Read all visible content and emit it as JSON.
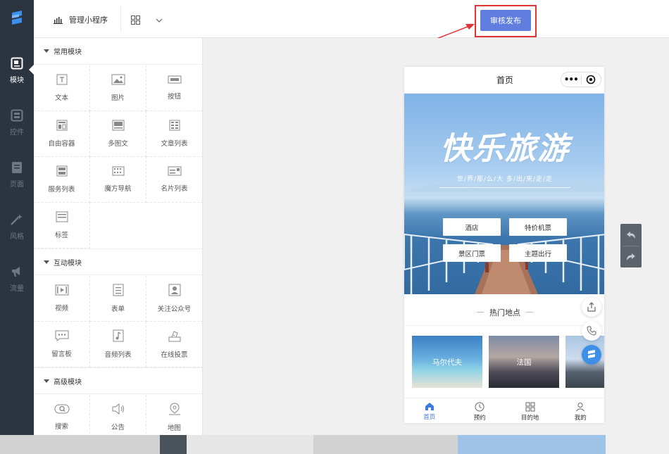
{
  "rail": {
    "items": [
      {
        "label": "模块",
        "icon": "module-icon",
        "active": true
      },
      {
        "label": "控件",
        "icon": "widget-icon",
        "active": false
      },
      {
        "label": "页面",
        "icon": "page-icon",
        "active": false
      },
      {
        "label": "风格",
        "icon": "style-wand-icon",
        "active": false
      },
      {
        "label": "流量",
        "icon": "traffic-megaphone-icon",
        "active": false
      }
    ]
  },
  "topbar": {
    "manage_label": "管理小程序",
    "publish_label": "审核发布"
  },
  "panel": {
    "sections": [
      {
        "title": "常用模块",
        "items": [
          {
            "label": "文本",
            "icon": "text-icon"
          },
          {
            "label": "图片",
            "icon": "image-icon"
          },
          {
            "label": "按钮",
            "icon": "button-icon"
          },
          {
            "label": "自由容器",
            "icon": "container-icon"
          },
          {
            "label": "多图文",
            "icon": "multi-image-text-icon"
          },
          {
            "label": "文章列表",
            "icon": "article-list-icon"
          },
          {
            "label": "服务列表",
            "icon": "service-list-icon"
          },
          {
            "label": "魔方导航",
            "icon": "cube-nav-icon"
          },
          {
            "label": "名片列表",
            "icon": "card-list-icon"
          },
          {
            "label": "标签",
            "icon": "tag-icon"
          }
        ]
      },
      {
        "title": "互动模块",
        "items": [
          {
            "label": "视频",
            "icon": "video-icon"
          },
          {
            "label": "表单",
            "icon": "form-icon"
          },
          {
            "label": "关注公众号",
            "icon": "follow-account-icon"
          },
          {
            "label": "留言板",
            "icon": "message-board-icon"
          },
          {
            "label": "音频列表",
            "icon": "audio-list-icon"
          },
          {
            "label": "在线投票",
            "icon": "vote-icon"
          }
        ]
      },
      {
        "title": "高级模块",
        "items": [
          {
            "label": "搜索",
            "icon": "search-icon"
          },
          {
            "label": "公告",
            "icon": "announcement-icon"
          },
          {
            "label": "地图",
            "icon": "map-pin-icon"
          }
        ]
      }
    ]
  },
  "phone": {
    "page_title": "首页",
    "banner": {
      "title": "快乐旅游",
      "subtitle": "世/界/那/么/大 多/出/来/走/走",
      "buttons": [
        "酒店",
        "特价机票",
        "景区门票",
        "主题出行"
      ]
    },
    "hot_title": "热门地点",
    "places": [
      {
        "label": "马尔代夫",
        "color": "#4c8fc9"
      },
      {
        "label": "法国",
        "color": "#6b6f86"
      },
      {
        "label": "",
        "color": "#8aa9c9"
      }
    ],
    "tabs": [
      {
        "label": "首页",
        "icon": "home-icon",
        "active": true
      },
      {
        "label": "预约",
        "icon": "clock-icon",
        "active": false
      },
      {
        "label": "目的地",
        "icon": "grid-icon",
        "active": false
      },
      {
        "label": "我的",
        "icon": "user-icon",
        "active": false
      }
    ]
  },
  "colors": {
    "accent": "#5f7ee0",
    "rail": "#2c3440",
    "highlight": "#e23434",
    "tab_active": "#3e7be0"
  }
}
